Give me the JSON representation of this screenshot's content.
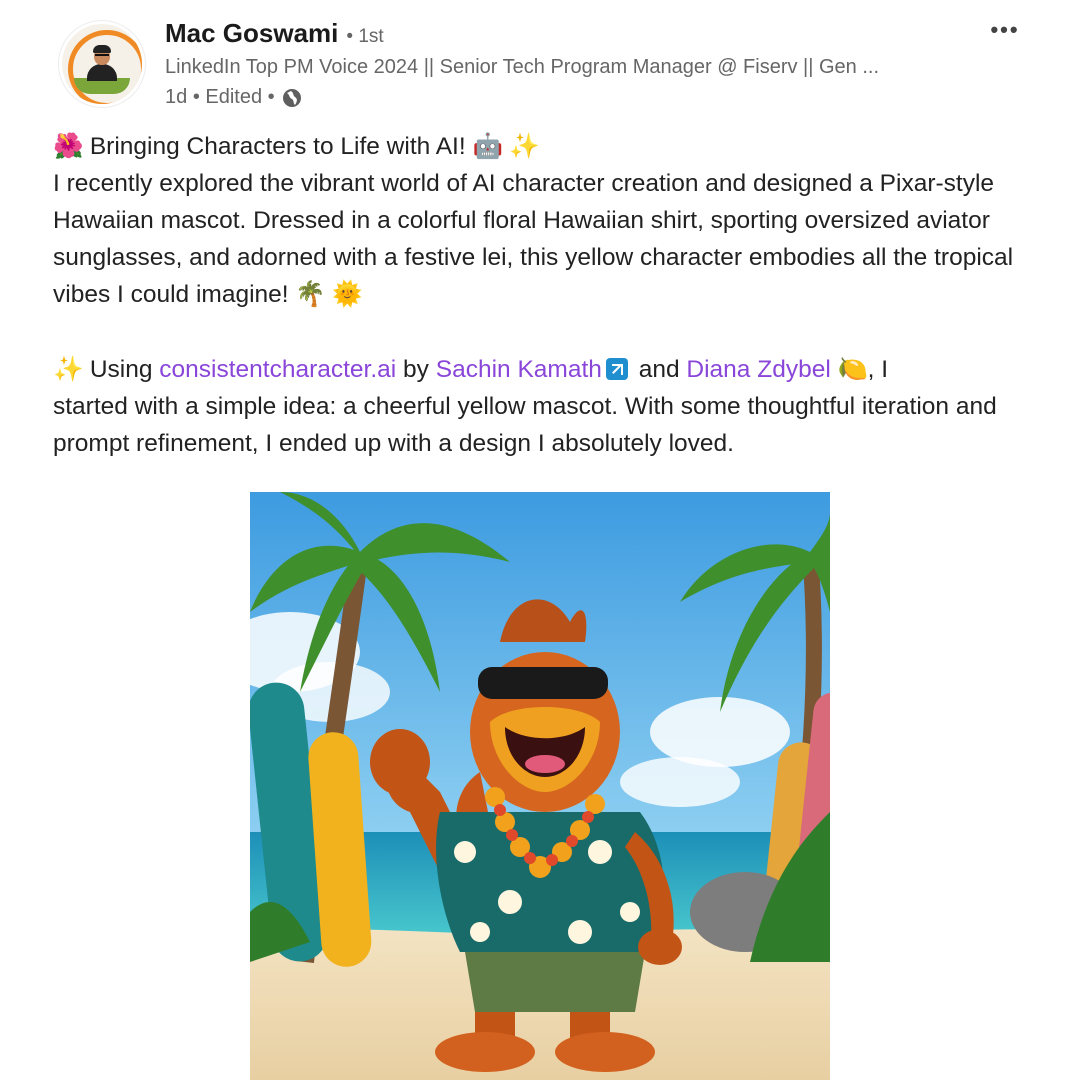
{
  "author": {
    "name": "Mac Goswami",
    "degree": "• 1st",
    "headline": "LinkedIn Top PM Voice 2024 || Senior Tech Program Manager @ Fiserv || Gen ...",
    "time": "1d",
    "edited": "• Edited •",
    "avatar_icon": "profile-photo",
    "visibility_icon": "globe-icon"
  },
  "menu": {
    "more_label": "•••"
  },
  "post": {
    "para1": {
      "emoji1": "🌺",
      "title": "Bringing Characters to Life with AI!",
      "emoji2": "🤖",
      "emoji3": "✨",
      "body": "I recently explored the vibrant world of AI character creation and designed a Pixar-style Hawaiian mascot. Dressed in a colorful floral Hawaiian shirt, sporting oversized aviator sunglasses, and adorned with a festive lei, this yellow character embodies all the tropical vibes I could imagine!",
      "emoji4": "🌴",
      "emoji5": "🌞"
    },
    "para2": {
      "emoji1": "✨",
      "using": "Using",
      "link1": "consistentcharacter.ai",
      "by": "by",
      "link2": "Sachin Kamath",
      "and": "and",
      "link3": "Diana Zdybel",
      "emoji2": "🍋",
      "after_link3": ", I",
      "body": "started with a simple idea: a cheerful yellow mascot. With some thoughtful iteration and prompt refinement, I ended up with a design I absolutely loved."
    }
  },
  "colors": {
    "link": "#8a46d9",
    "text": "#222222",
    "muted": "#666666",
    "linkedin_blue": "#1f8fd0"
  }
}
